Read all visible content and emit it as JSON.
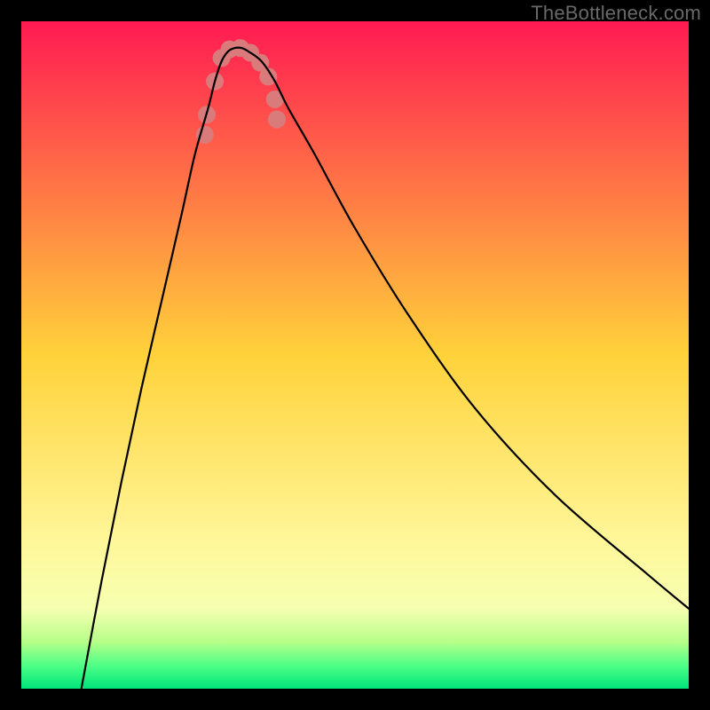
{
  "watermark": "TheBottleneck.com",
  "chart_data": {
    "type": "line",
    "title": "",
    "xlabel": "",
    "ylabel": "",
    "x_range": [
      0,
      100
    ],
    "y_range": [
      0,
      100
    ],
    "background_gradient": {
      "stops": [
        {
          "offset": 0.0,
          "color": "#ff1a52"
        },
        {
          "offset": 0.5,
          "color": "#ffd23a"
        },
        {
          "offset": 0.78,
          "color": "#fff79a"
        },
        {
          "offset": 0.88,
          "color": "#f6ffb0"
        },
        {
          "offset": 0.93,
          "color": "#b7ff8a"
        },
        {
          "offset": 0.965,
          "color": "#4eff86"
        },
        {
          "offset": 1.0,
          "color": "#00e57a"
        }
      ],
      "green_band_y": [
        93,
        100
      ]
    },
    "series": [
      {
        "name": "bottleneck-curve",
        "x": [
          9,
          12,
          15,
          18,
          21,
          24,
          26,
          28,
          29,
          30,
          31,
          32,
          33,
          34,
          36,
          38,
          40,
          44,
          50,
          58,
          68,
          80,
          94,
          100
        ],
        "y": [
          0,
          16,
          31,
          45,
          58,
          71,
          80,
          87,
          91,
          94,
          95.5,
          96,
          96,
          95.5,
          94,
          91,
          87,
          80,
          69,
          56,
          42,
          29,
          17,
          12
        ],
        "stroke": "#000000",
        "stroke_width": 2.2
      }
    ],
    "markers": {
      "name": "highlight-dots",
      "color": "#d97b7b",
      "radius": 10,
      "points": [
        {
          "x": 27.5,
          "y": 83
        },
        {
          "x": 27.8,
          "y": 86
        },
        {
          "x": 29.0,
          "y": 91
        },
        {
          "x": 30.0,
          "y": 94.5
        },
        {
          "x": 31.2,
          "y": 95.8
        },
        {
          "x": 32.8,
          "y": 96
        },
        {
          "x": 34.3,
          "y": 95.3
        },
        {
          "x": 35.8,
          "y": 93.8
        },
        {
          "x": 37.0,
          "y": 91.7
        },
        {
          "x": 38.0,
          "y": 88.3
        },
        {
          "x": 38.3,
          "y": 85.3
        }
      ]
    }
  }
}
